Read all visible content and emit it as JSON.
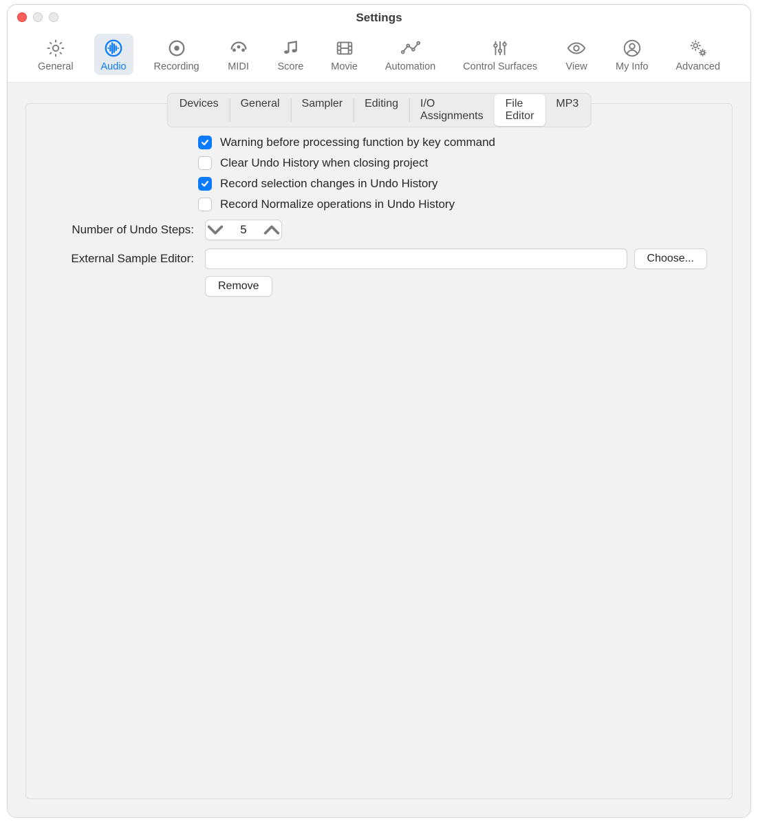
{
  "window": {
    "title": "Settings"
  },
  "toolbar": {
    "items": [
      {
        "key": "general",
        "label": "General",
        "icon": "gear-icon"
      },
      {
        "key": "audio",
        "label": "Audio",
        "icon": "waveform-icon",
        "selected": true
      },
      {
        "key": "recording",
        "label": "Recording",
        "icon": "record-icon"
      },
      {
        "key": "midi",
        "label": "MIDI",
        "icon": "midi-icon"
      },
      {
        "key": "score",
        "label": "Score",
        "icon": "score-icon"
      },
      {
        "key": "movie",
        "label": "Movie",
        "icon": "film-icon"
      },
      {
        "key": "automation",
        "label": "Automation",
        "icon": "automation-icon"
      },
      {
        "key": "control-surfaces",
        "label": "Control Surfaces",
        "icon": "sliders-icon"
      },
      {
        "key": "view",
        "label": "View",
        "icon": "eye-icon"
      },
      {
        "key": "my-info",
        "label": "My Info",
        "icon": "person-icon"
      },
      {
        "key": "advanced",
        "label": "Advanced",
        "icon": "gears-icon"
      }
    ]
  },
  "subtabs": {
    "items": [
      {
        "key": "devices",
        "label": "Devices"
      },
      {
        "key": "general",
        "label": "General"
      },
      {
        "key": "sampler",
        "label": "Sampler"
      },
      {
        "key": "editing",
        "label": "Editing"
      },
      {
        "key": "io-assignments",
        "label": "I/O Assignments"
      },
      {
        "key": "file-editor",
        "label": "File Editor",
        "active": true
      },
      {
        "key": "mp3",
        "label": "MP3"
      }
    ]
  },
  "checkboxes": [
    {
      "key": "warn-key-command",
      "label": "Warning before processing function by key command",
      "checked": true
    },
    {
      "key": "clear-undo-close",
      "label": "Clear Undo History when closing project",
      "checked": false
    },
    {
      "key": "record-selection",
      "label": "Record selection changes in Undo History",
      "checked": true
    },
    {
      "key": "record-normalize",
      "label": "Record Normalize operations in Undo History",
      "checked": false
    }
  ],
  "fields": {
    "undo_steps_label": "Number of Undo Steps:",
    "undo_steps_value": "5",
    "external_editor_label": "External Sample Editor:",
    "external_editor_value": "",
    "choose_label": "Choose...",
    "remove_label": "Remove"
  }
}
